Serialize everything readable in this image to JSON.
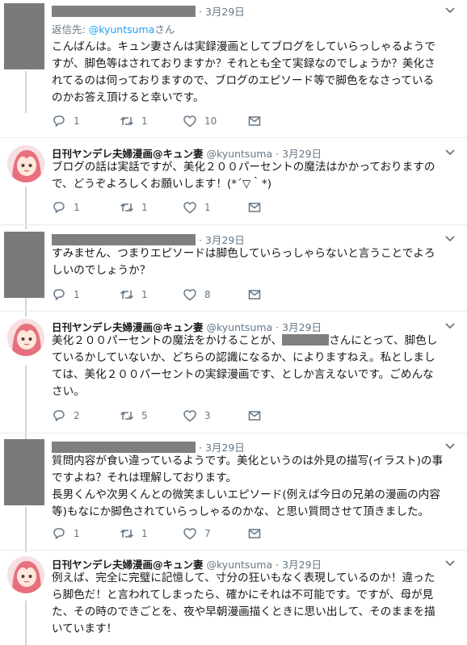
{
  "tweets": [
    {
      "redacted": true,
      "date": "3月29日",
      "replying_prefix": "返信先: ",
      "replying_handle": "@kyuntsuma",
      "replying_suffix": "さん",
      "text": [
        "こんばんは。キュン妻さんは実録漫画としてブログをしていらっしゃるようで",
        "すが、脚色等はされておりますか？それとも全て実録なのでしょうか？美化さ",
        "れてるのは伺っておりますので、ブログのエピソード等で脚色をなさっている",
        "のかお答え頂けると幸いです。"
      ],
      "replies": "1",
      "retweets": "1",
      "likes": "10"
    },
    {
      "name": "日刊ヤンデレ夫婦漫画@キュン妻",
      "handle": "@kyuntsuma",
      "date": "3月29日",
      "text": [
        "ブログの話は実話ですが、美化２００パーセントの魔法はかかっておりますの",
        "で、どうぞよろしくお願いします！(*´▽｀*)"
      ],
      "replies": "1",
      "retweets": "1",
      "likes": "1"
    },
    {
      "redacted": true,
      "date": "3月29日",
      "text": [
        "すみません、つまりエピソードは脚色していらっしゃらないと言うことでよろ",
        "しいのでしょうか？"
      ],
      "replies": "1",
      "retweets": "1",
      "likes": "8"
    },
    {
      "name": "日刊ヤンデレ夫婦漫画@キュン妻",
      "handle": "@kyuntsuma",
      "date": "3月29日",
      "text_first_pre": "美化２００パーセントの魔法をかけることが、",
      "text_first_post": "さんにとって、脚色し",
      "text": [
        "ているかしていないか、どちらの認識になるか、によりますねえ。私としまし",
        "ては、美化２００パーセントの実録漫画です、としか言えないです。ごめんな",
        "さい。"
      ],
      "replies": "2",
      "retweets": "5",
      "likes": "3"
    },
    {
      "redacted": true,
      "date": "3月29日",
      "text": [
        "質問内容が食い違っているようです。美化というのは外見の描写(イラスト)の事",
        "ですよね？それは理解しております。",
        "長男くんや次男くんとの微笑ましいエピソード(例えば今日の兄弟の漫画の内容",
        "等)もなにか脚色されていらっしゃるのかな、と思い質問させて頂きました。"
      ],
      "replies": "1",
      "retweets": "1",
      "likes": "7"
    },
    {
      "name": "日刊ヤンデレ夫婦漫画@キュン妻",
      "handle": "@kyuntsuma",
      "date": "3月29日",
      "text": [
        "例えば、完全に完璧に記憶して、寸分の狂いもなく表現しているのか！違った",
        "ら脚色だ！と言われてしまったら、確かにそれは不可能です。ですが、母が見",
        "た、その時のできごとを、夜や早朝漫画描くときに思い出して、そのままを描",
        "いています！"
      ]
    }
  ]
}
